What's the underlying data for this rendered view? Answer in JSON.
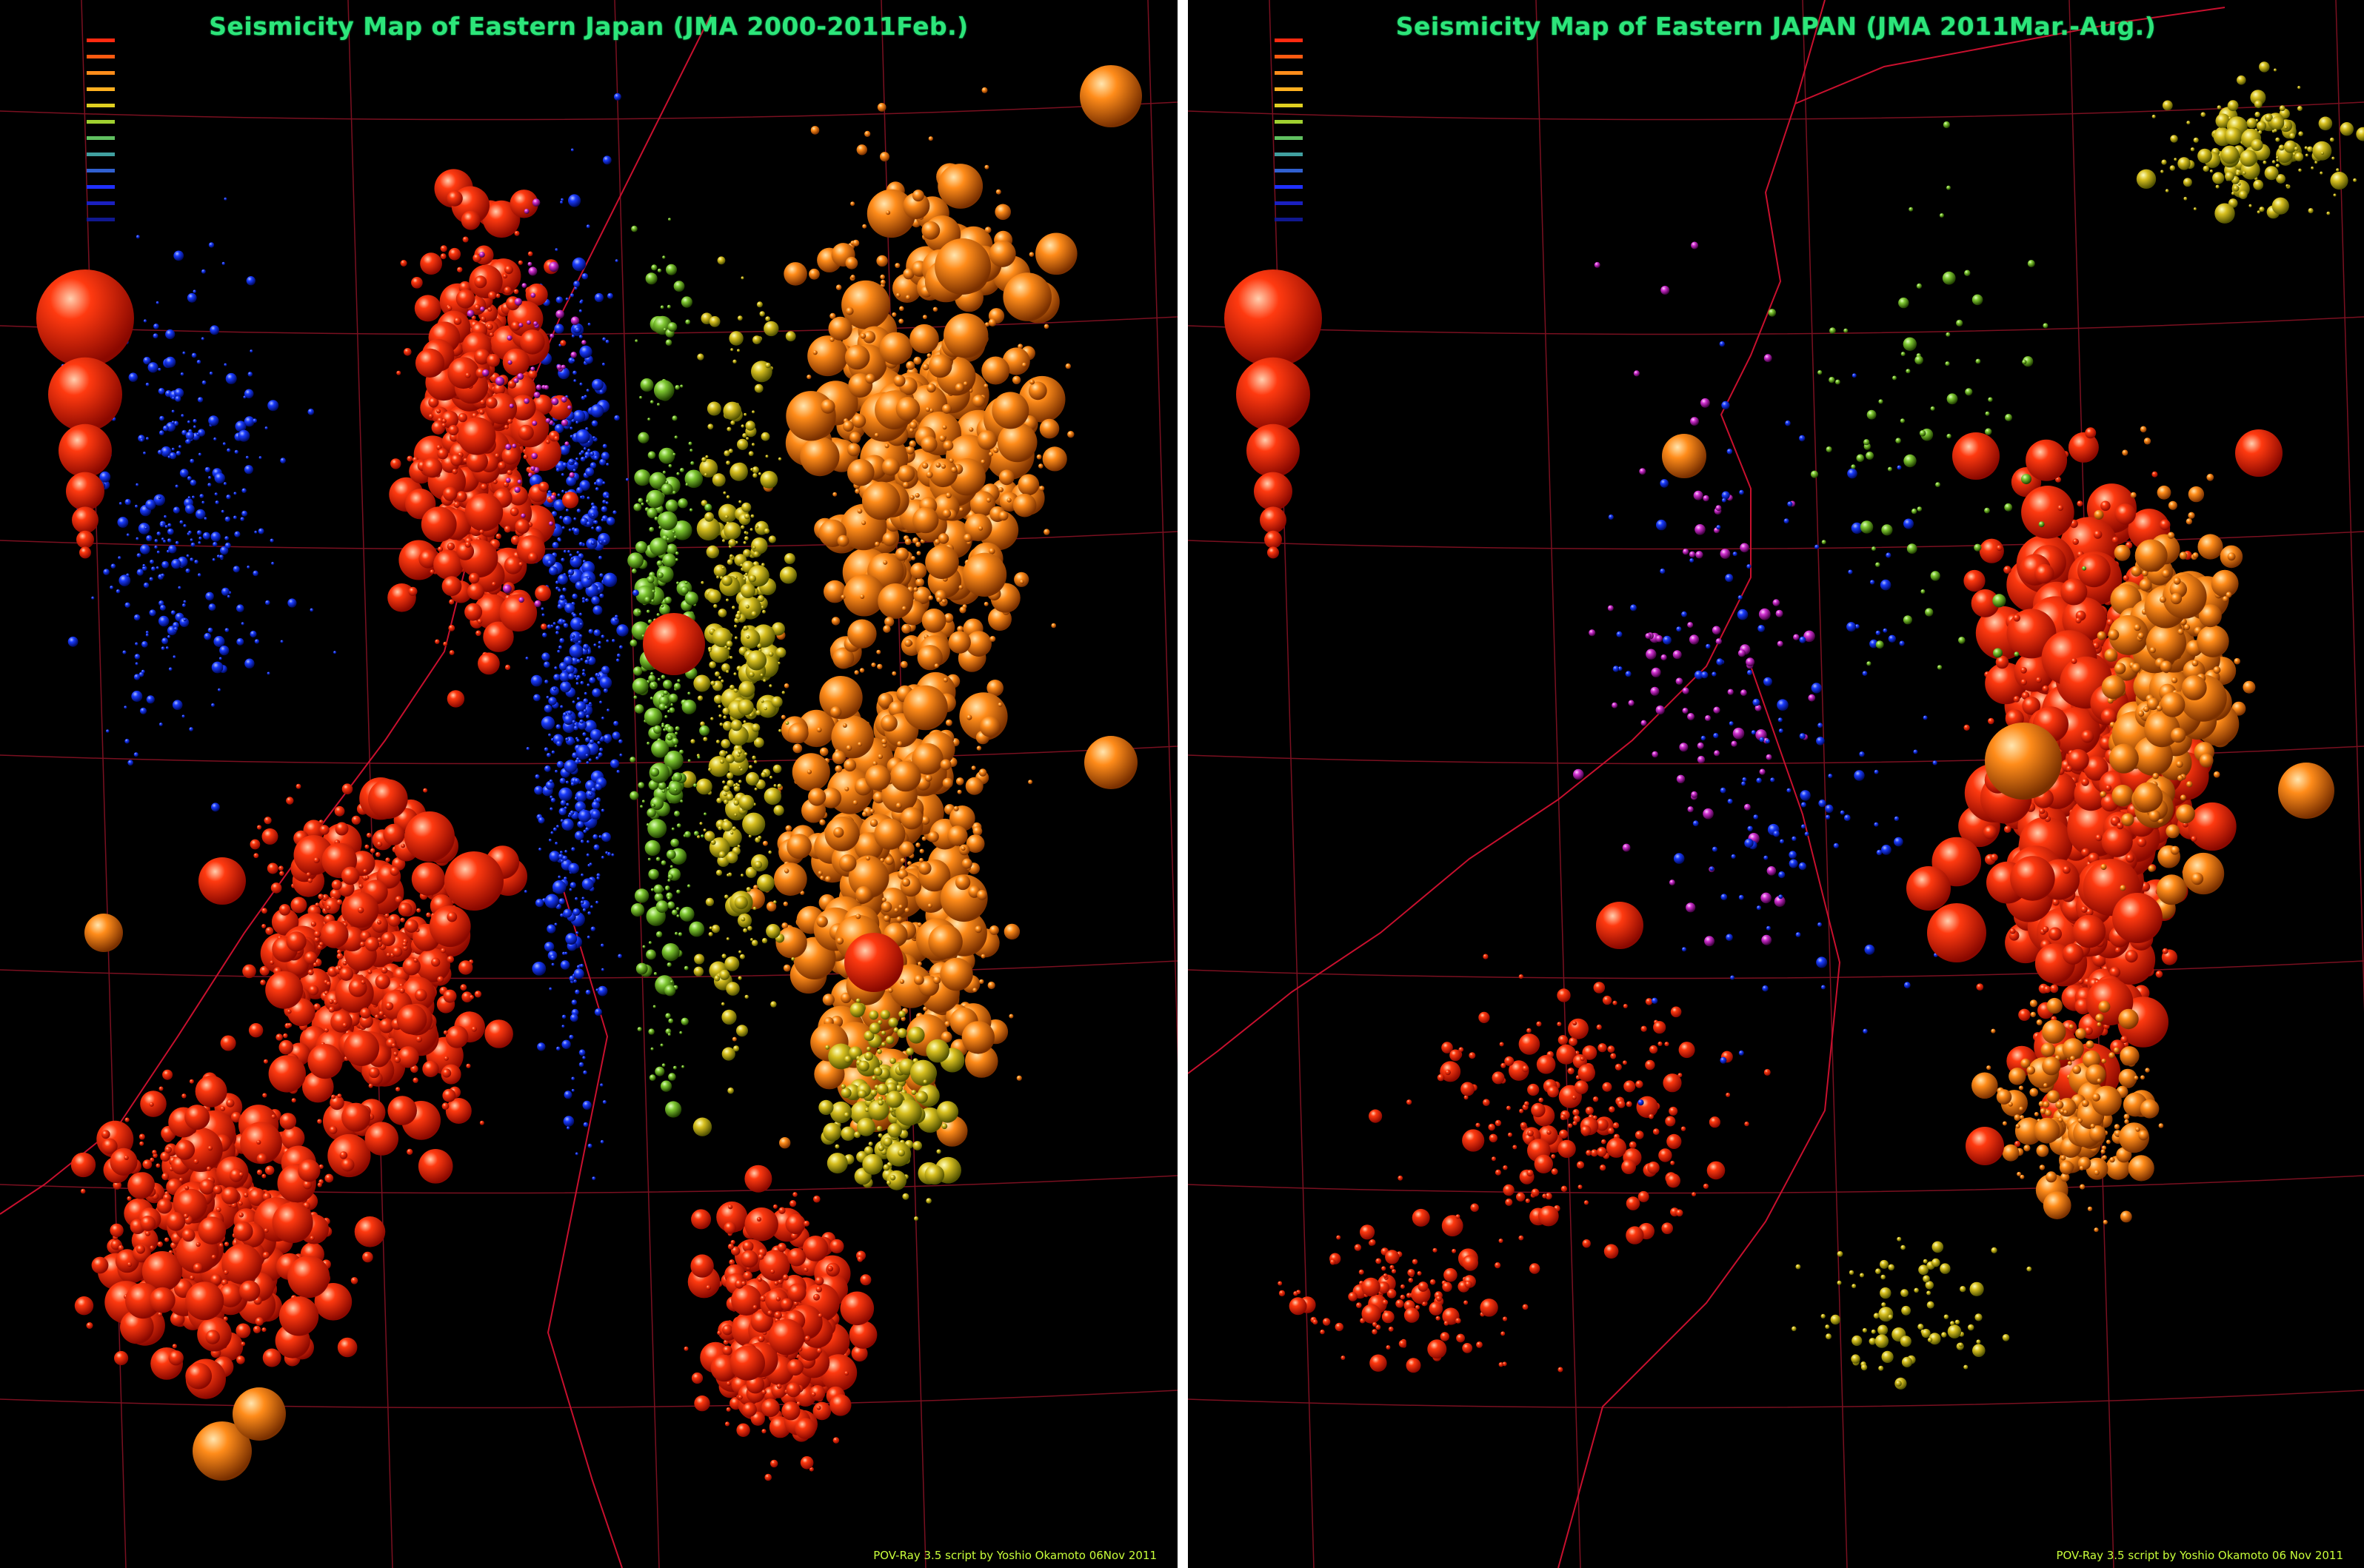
{
  "panels": [
    {
      "title": "Seismicity Map of Eastern Japan (JMA 2000-2011Feb.)",
      "credit": "POV-Ray 3.5 script by Yoshio Okamoto 06Nov 2011"
    },
    {
      "title": "Seismicity Map of Eastern JAPAN (JMA 2011Mar.-Aug.)",
      "credit": "POV-Ray 3.5 script by Yoshio Okamoto 06 Nov 2011"
    }
  ],
  "colors": {
    "background": "#000000",
    "divider": "#ffffff",
    "title": "#2de57a",
    "credit": "#c9ff3a",
    "grid": "#7a1020",
    "coastline": "#c8102e",
    "shallow": "#ff2a10",
    "mid_depth": "#ff8c1a",
    "deeper": "#9acd32",
    "deepest": "#1a2cff"
  }
}
